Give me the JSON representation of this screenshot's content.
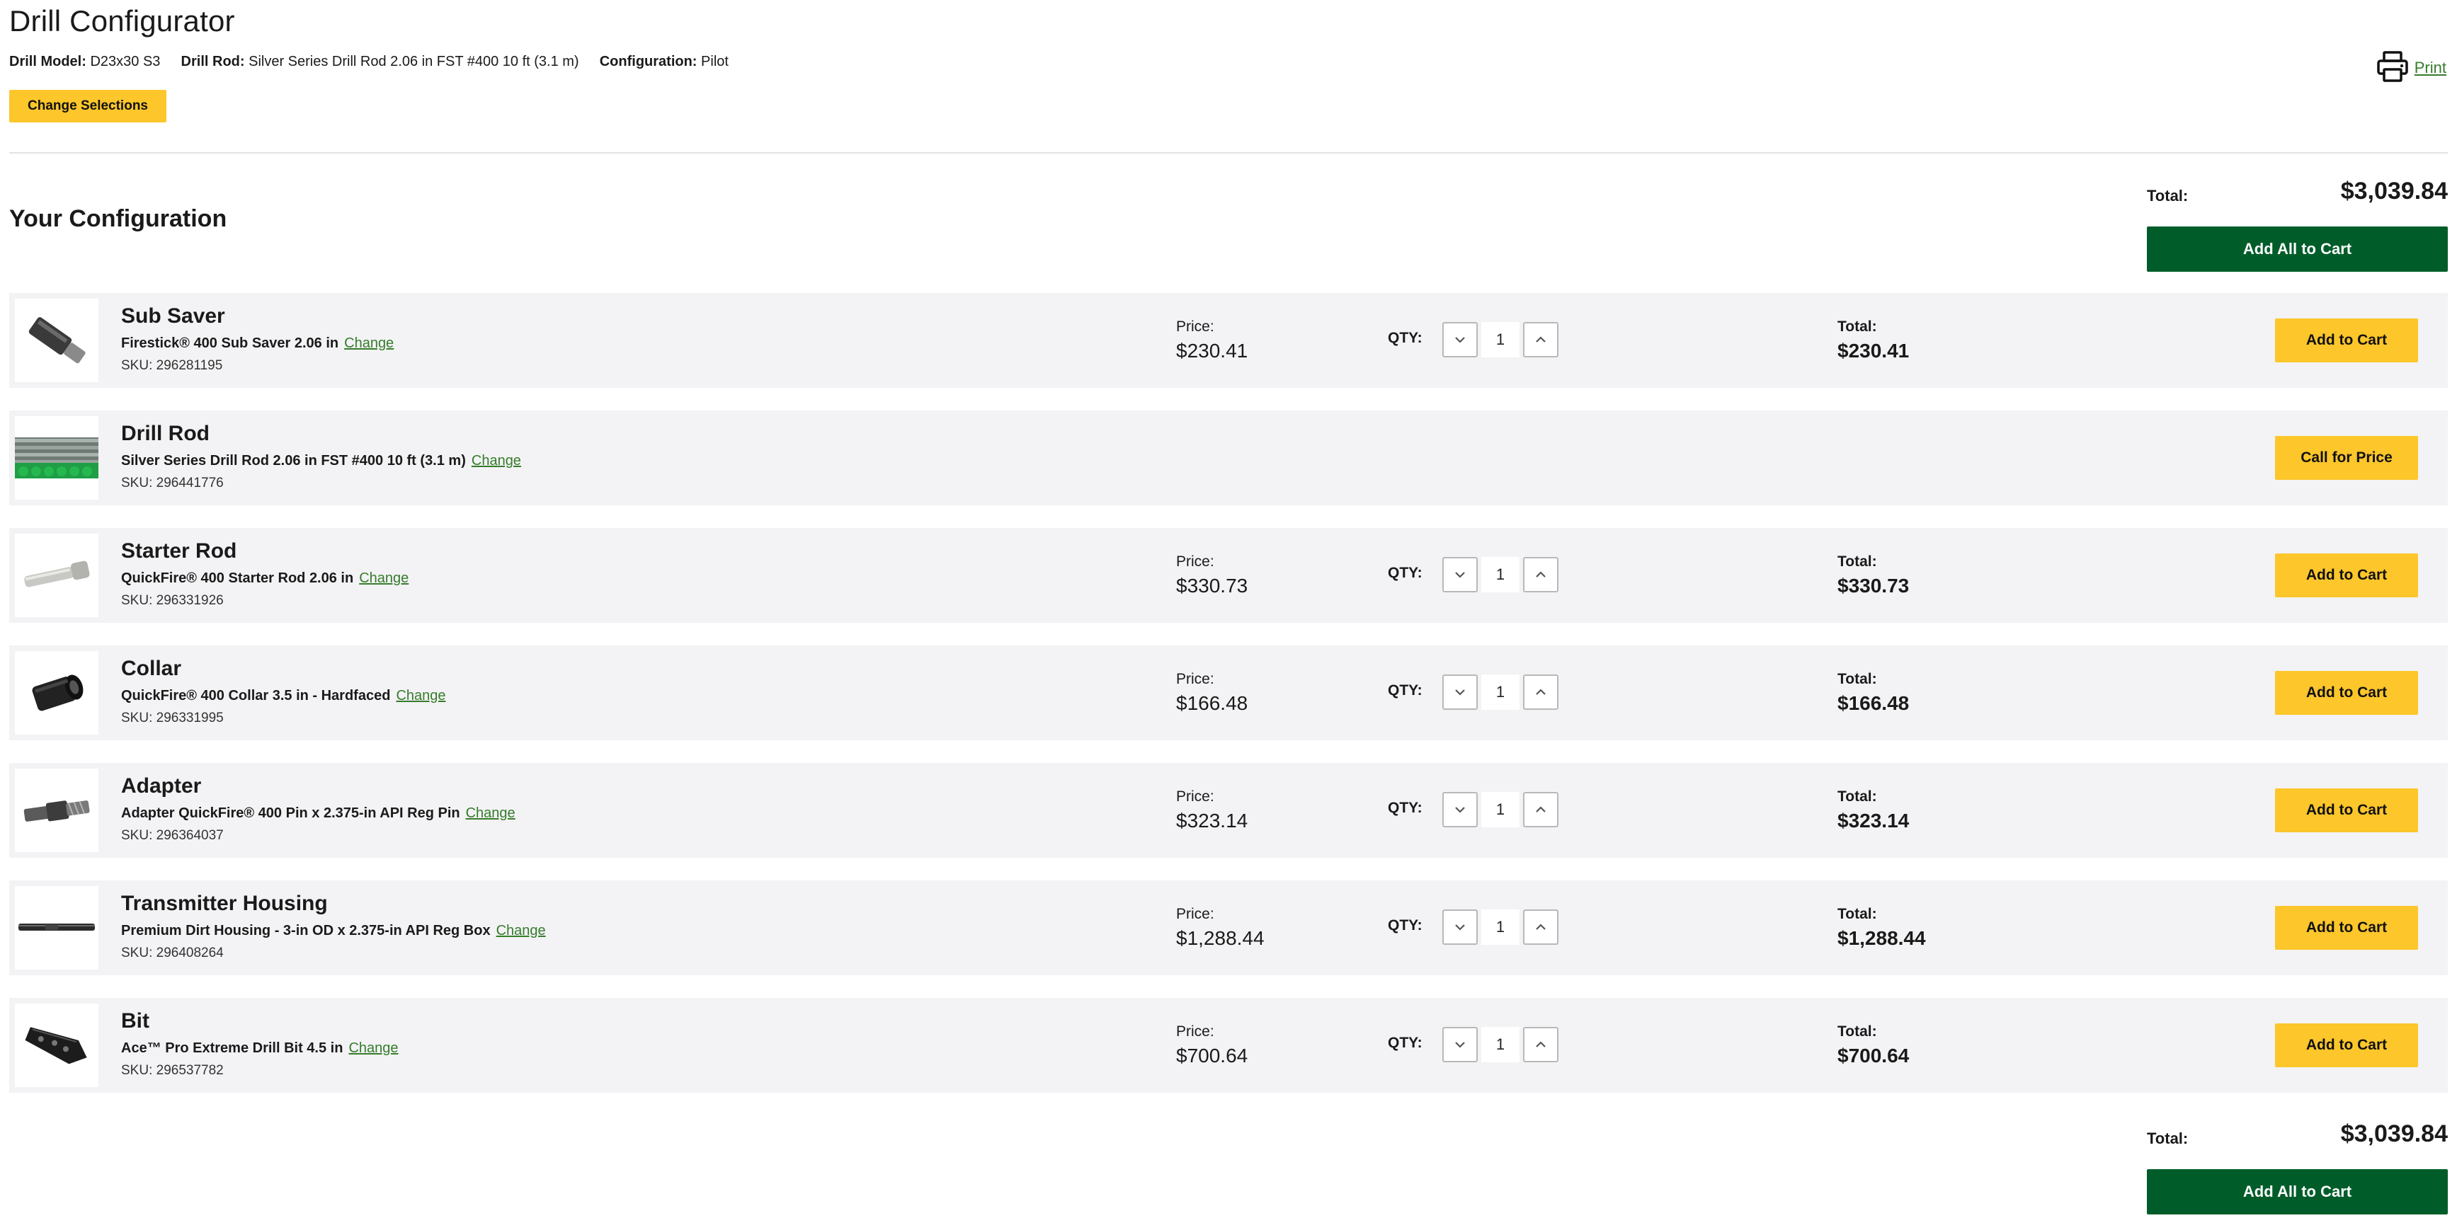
{
  "header": {
    "title": "Drill Configurator",
    "meta": [
      {
        "label": "Drill Model:",
        "value": "D23x30 S3"
      },
      {
        "label": "Drill Rod:",
        "value": "Silver Series Drill Rod 2.06 in FST #400 10 ft (3.1 m)"
      },
      {
        "label": "Configuration:",
        "value": "Pilot"
      }
    ],
    "change_selections_label": "Change Selections",
    "print_label": "Print",
    "print_icon": "printer-icon"
  },
  "configuration": {
    "heading": "Your Configuration",
    "total_label": "Total:",
    "total_value": "$3,039.84",
    "add_all_label": "Add All to Cart"
  },
  "labels": {
    "price": "Price:",
    "qty": "QTY:",
    "total": "Total:",
    "change": "Change",
    "add_to_cart": "Add to Cart",
    "call_for_price": "Call for Price"
  },
  "items": [
    {
      "category": "Sub Saver",
      "product": "Firestick® 400 Sub Saver 2.06 in",
      "sku": "SKU: 296281195",
      "price": "$230.41",
      "qty": "1",
      "total": "$230.41",
      "image": "sub-saver-image"
    },
    {
      "category": "Drill Rod",
      "product": "Silver Series Drill Rod 2.06 in FST #400 10 ft (3.1 m)",
      "sku": "SKU: 296441776",
      "image": "drill-rod-image"
    },
    {
      "category": "Starter Rod",
      "product": "QuickFire® 400 Starter Rod 2.06 in",
      "sku": "SKU: 296331926",
      "price": "$330.73",
      "qty": "1",
      "total": "$330.73",
      "image": "starter-rod-image"
    },
    {
      "category": "Collar",
      "product": "QuickFire® 400 Collar 3.5 in - Hardfaced",
      "sku": "SKU: 296331995",
      "price": "$166.48",
      "qty": "1",
      "total": "$166.48",
      "image": "collar-image"
    },
    {
      "category": "Adapter",
      "product": "Adapter QuickFire® 400 Pin x 2.375-in API Reg Pin",
      "sku": "SKU: 296364037",
      "price": "$323.14",
      "qty": "1",
      "total": "$323.14",
      "image": "adapter-image"
    },
    {
      "category": "Transmitter Housing",
      "product": "Premium Dirt Housing - 3-in OD x 2.375-in API Reg Box",
      "sku": "SKU: 296408264",
      "price": "$1,288.44",
      "qty": "1",
      "total": "$1,288.44",
      "image": "transmitter-housing-image"
    },
    {
      "category": "Bit",
      "product": "Ace™ Pro Extreme Drill Bit 4.5 in",
      "sku": "SKU: 296537782",
      "price": "$700.64",
      "qty": "1",
      "total": "$700.64",
      "image": "drill-bit-image"
    }
  ],
  "colors": {
    "accent_yellow": "#fdc62a",
    "brand_green": "#005d2a",
    "link_green": "#367c2b",
    "row_background": "#f3f3f5"
  }
}
